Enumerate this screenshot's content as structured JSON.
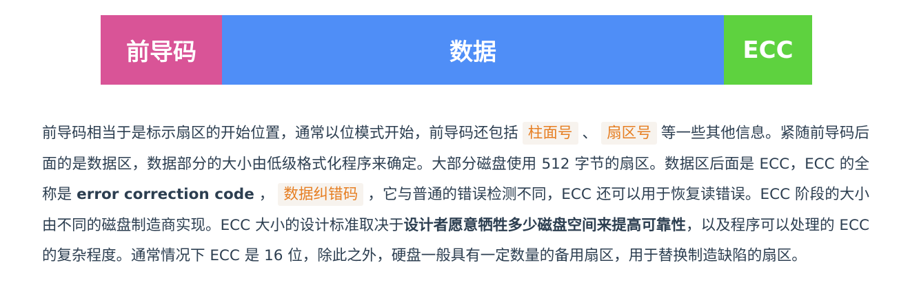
{
  "diagram": {
    "preamble_label": "前导码",
    "data_label": "数据",
    "ecc_label": "ECC",
    "colors": {
      "preamble": "#d95497",
      "data": "#4f8ef7",
      "ecc": "#5ed23f"
    }
  },
  "paragraph": {
    "t1": "前导码相当于是标示扇区的开始位置，通常以位模式开始，前导码还包括",
    "hl1": "柱面号",
    "t2": "、",
    "hl2": "扇区号",
    "t3": "等一些其他信息。紧随前导码后面的是数据区，数据部分的大小由低级格式化程序来确定。大部分磁盘使用 512 字节的扇区。数据区后面是 ECC，ECC 的全称是",
    "b1": "error correction code",
    "t4": "，",
    "hl3": "数据纠错码",
    "t5": "，它与普通的错误检测不同，ECC 还可以用于恢复读错误。ECC 阶段的大小由不同的磁盘制造商实现。ECC 大小的设计标准取决于",
    "b2": "设计者愿意牺牲多少磁盘空间来提高可靠性",
    "t6": "，以及程序可以处理的 ECC 的复杂程度。通常情况下 ECC 是 16 位，除此之外，硬盘一般具有一定数量的备用扇区，用于替换制造缺陷的扇区。"
  }
}
